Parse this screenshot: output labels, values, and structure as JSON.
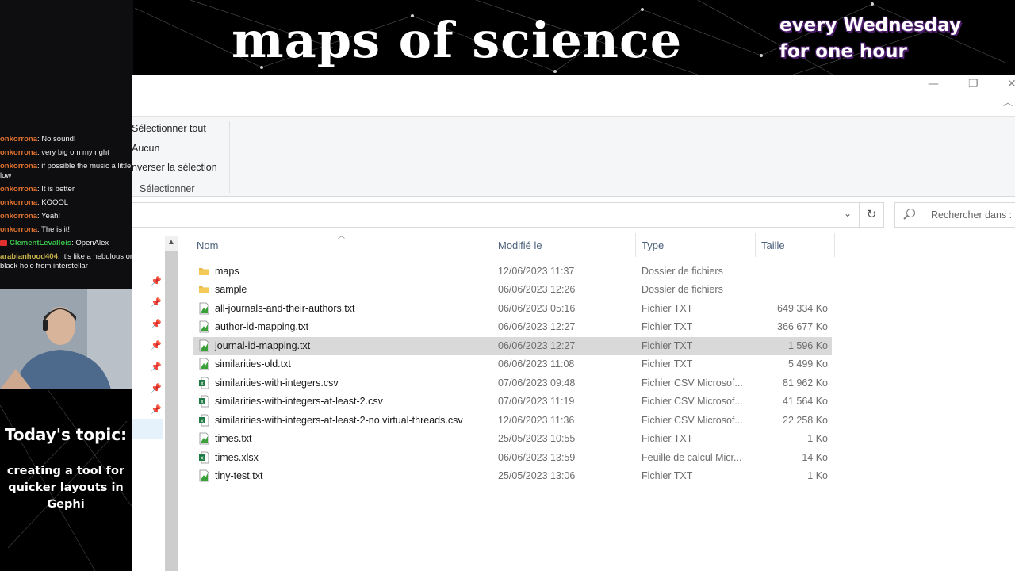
{
  "banner": {
    "title": "maps of science",
    "schedule_line1": "every Wednesday",
    "schedule_line2": "for one hour"
  },
  "chat": {
    "messages": [
      {
        "user": "onkorrona",
        "text": "No sound!"
      },
      {
        "user": "onkorrona",
        "text": "very big om my right"
      },
      {
        "user": "onkorrona",
        "text": "if possible the music a little low"
      },
      {
        "user": "onkorrona",
        "text": "It is better"
      },
      {
        "user": "onkorrona",
        "text": "KOOOL"
      },
      {
        "user": "onkorrona",
        "text": "Yeah!"
      },
      {
        "user": "onkorrona",
        "text": "The is it!"
      },
      {
        "user": "ClementLevallois",
        "text": "OpenAlex"
      },
      {
        "user": "arabianhood404",
        "text": "It's like a nebulous or black hole from interstellar"
      }
    ]
  },
  "topic": {
    "title": "Today's topic:",
    "text": "creating a tool for quicker layouts in Gephi"
  },
  "ribbon": {
    "select_all": "Sélectionner tout",
    "select_none": "Aucun",
    "invert_selection": "nverser la sélection",
    "group_label": "Sélectionner"
  },
  "search": {
    "placeholder": "Rechercher dans :"
  },
  "columns": {
    "name": "Nom",
    "modified": "Modifié le",
    "type": "Type",
    "size": "Taille"
  },
  "files": [
    {
      "name": "maps",
      "date": "12/06/2023 11:37",
      "type": "Dossier de fichiers",
      "size": "",
      "icon": "folder-icon"
    },
    {
      "name": "sample",
      "date": "06/06/2023 12:26",
      "type": "Dossier de fichiers",
      "size": "",
      "icon": "folder-icon"
    },
    {
      "name": "all-journals-and-their-authors.txt",
      "date": "06/06/2023 05:16",
      "type": "Fichier TXT",
      "size": "649 334 Ko",
      "icon": "text-file-icon"
    },
    {
      "name": "author-id-mapping.txt",
      "date": "06/06/2023 12:27",
      "type": "Fichier TXT",
      "size": "366 677 Ko",
      "icon": "text-file-icon"
    },
    {
      "name": "journal-id-mapping.txt",
      "date": "06/06/2023 12:27",
      "type": "Fichier TXT",
      "size": "1 596 Ko",
      "icon": "text-file-icon",
      "selected": true
    },
    {
      "name": "similarities-old.txt",
      "date": "06/06/2023 11:08",
      "type": "Fichier TXT",
      "size": "5 499 Ko",
      "icon": "text-file-icon"
    },
    {
      "name": "similarities-with-integers.csv",
      "date": "07/06/2023 09:48",
      "type": "Fichier CSV Microsof...",
      "size": "81 962 Ko",
      "icon": "excel-file-icon"
    },
    {
      "name": "similarities-with-integers-at-least-2.csv",
      "date": "07/06/2023 11:19",
      "type": "Fichier CSV Microsof...",
      "size": "41 564 Ko",
      "icon": "excel-file-icon"
    },
    {
      "name": "similarities-with-integers-at-least-2-no virtual-threads.csv",
      "date": "12/06/2023 11:36",
      "type": "Fichier CSV Microsof...",
      "size": "22 258 Ko",
      "icon": "excel-file-icon"
    },
    {
      "name": "times.txt",
      "date": "25/05/2023 10:55",
      "type": "Fichier TXT",
      "size": "1 Ko",
      "icon": "text-file-icon"
    },
    {
      "name": "times.xlsx",
      "date": "06/06/2023 13:59",
      "type": "Feuille de calcul Micr...",
      "size": "14 Ko",
      "icon": "excel-file-icon"
    },
    {
      "name": "tiny-test.txt",
      "date": "25/05/2023 13:06",
      "type": "Fichier TXT",
      "size": "1 Ko",
      "icon": "text-file-icon"
    }
  ],
  "colors": {
    "selected_row": "#d9d9d9",
    "header_text": "#4c607a",
    "chat_user": "#e0712e",
    "schedule_outline": "#4b1d6b"
  }
}
